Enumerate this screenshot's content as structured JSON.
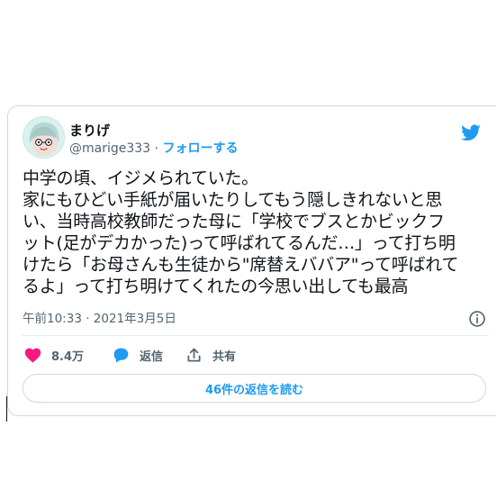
{
  "tweet": {
    "author": {
      "name": "まりげ",
      "handle": "@marige333",
      "separator": "·",
      "follow_label": "フォローする",
      "avatar_icon": "avatar-icon"
    },
    "text_lines": [
      "中学の頃、イジメられていた。",
      "家にもひどい手紙が届いたりしてもう隠しきれないと思",
      "い、当時高校教師だった母に「学校でブスとかビックフ",
      "ット(足がデカかった)って呼ばれてるんだ…」って打ち明",
      "けたら「お母さんも生徒から\"席替えババア\"って呼ばれて",
      "るよ」って打ち明けてくれたの今思い出しても最高"
    ],
    "timestamp": "午前10:33 · 2021年3月5日",
    "actions": {
      "like_count": "8.4万",
      "reply_label": "返信",
      "share_label": "共有"
    },
    "read_replies_label": "46件の返信を読む",
    "icons": {
      "logo": "twitter-bird-icon",
      "info": "info-icon",
      "like": "heart-icon",
      "reply": "reply-bubble-icon",
      "share": "share-icon"
    },
    "colors": {
      "brand": "#1d9bf0",
      "like": "#f91880",
      "text": "#0f1419",
      "secondary_text": "#536471",
      "border": "#cfd9de"
    }
  }
}
